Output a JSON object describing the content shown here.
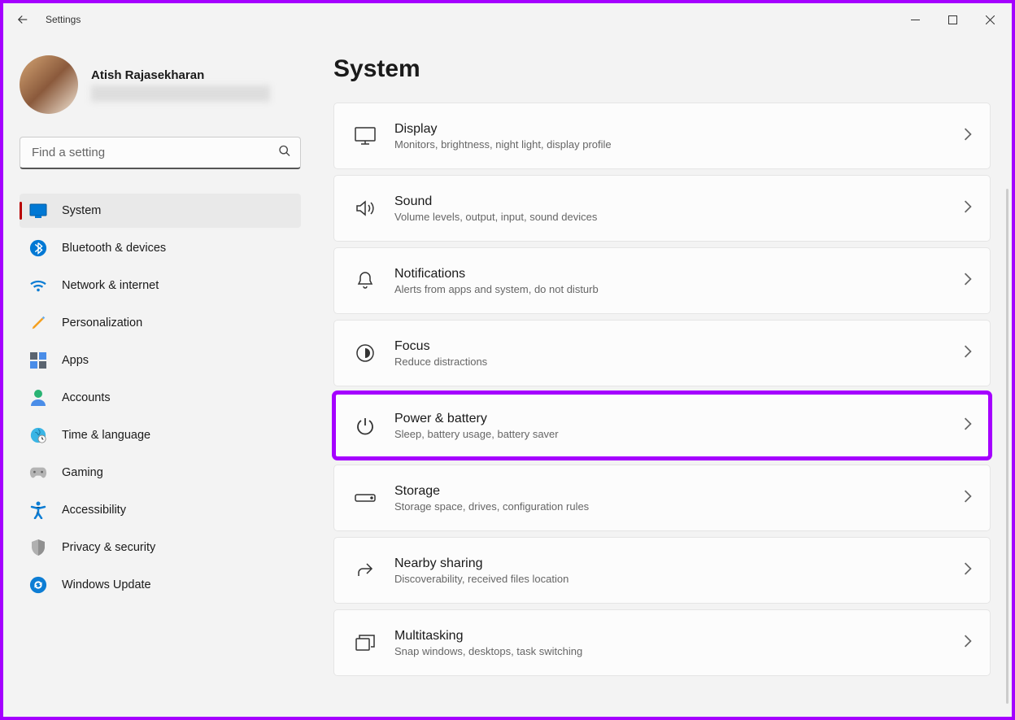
{
  "app": {
    "title": "Settings"
  },
  "profile": {
    "name": "Atish Rajasekharan"
  },
  "search": {
    "placeholder": "Find a setting"
  },
  "nav": [
    {
      "label": "System"
    },
    {
      "label": "Bluetooth & devices"
    },
    {
      "label": "Network & internet"
    },
    {
      "label": "Personalization"
    },
    {
      "label": "Apps"
    },
    {
      "label": "Accounts"
    },
    {
      "label": "Time & language"
    },
    {
      "label": "Gaming"
    },
    {
      "label": "Accessibility"
    },
    {
      "label": "Privacy & security"
    },
    {
      "label": "Windows Update"
    }
  ],
  "page": {
    "title": "System"
  },
  "cards": [
    {
      "title": "Display",
      "sub": "Monitors, brightness, night light, display profile"
    },
    {
      "title": "Sound",
      "sub": "Volume levels, output, input, sound devices"
    },
    {
      "title": "Notifications",
      "sub": "Alerts from apps and system, do not disturb"
    },
    {
      "title": "Focus",
      "sub": "Reduce distractions"
    },
    {
      "title": "Power & battery",
      "sub": "Sleep, battery usage, battery saver"
    },
    {
      "title": "Storage",
      "sub": "Storage space, drives, configuration rules"
    },
    {
      "title": "Nearby sharing",
      "sub": "Discoverability, received files location"
    },
    {
      "title": "Multitasking",
      "sub": "Snap windows, desktops, task switching"
    }
  ],
  "highlight_index": 4
}
